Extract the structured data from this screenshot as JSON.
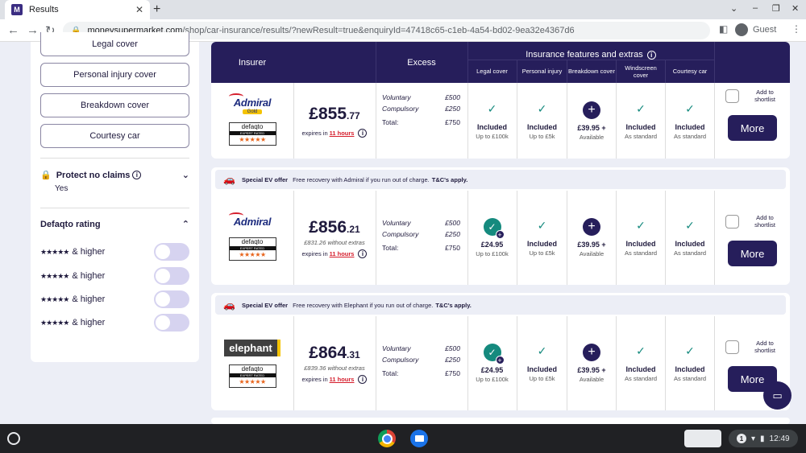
{
  "browser": {
    "tab_title": "Results",
    "favicon_letter": "M",
    "url_domain": "moneysupermarket.com",
    "url_path": "/shop/car-insurance/results/?newResult=true&enquiryId=47418c65-c1eb-4a54-bd02-9ea32e4367d6",
    "profile_label": "Guest"
  },
  "sidebar": {
    "filter_buttons": [
      "Legal cover",
      "Personal injury cover",
      "Breakdown cover",
      "Courtesy car"
    ],
    "protect_no_claims": {
      "label": "Protect no claims",
      "value": "Yes"
    },
    "defaqto": {
      "heading": "Defaqto rating",
      "rows": [
        {
          "stars": "★★★★★",
          "label": "& higher"
        },
        {
          "stars": "★★★★★",
          "label": "& higher"
        },
        {
          "stars": "★★★★★",
          "label": "& higher"
        },
        {
          "stars": "★★★★★",
          "label": "& higher"
        }
      ]
    }
  },
  "table_header": {
    "insurer": "Insurer",
    "excess": "Excess",
    "features_title": "Insurance features and extras",
    "features": [
      "Legal cover",
      "Personal injury",
      "Breakdown cover",
      "Windscreen cover",
      "Courtesy car"
    ]
  },
  "results": [
    {
      "insurer_logo": "Admiral",
      "insurer_badge": "Gold",
      "defaqto": {
        "name": "defaqto",
        "band": "EXPERT RATED",
        "stars": "★★★★★"
      },
      "price_major": "£855",
      "price_minor": ".77",
      "without_extras": "",
      "expires_prefix": "expires in",
      "expires_hours": "11 hours",
      "excess": {
        "voluntary_label": "Voluntary",
        "voluntary": "£500",
        "compulsory_label": "Compulsory",
        "compulsory": "£250",
        "total_label": "Total:",
        "total": "£750"
      },
      "features": [
        {
          "icon": "tick",
          "value": "Included",
          "sub": "Up to £100k"
        },
        {
          "icon": "tick",
          "value": "Included",
          "sub": "Up to £5k"
        },
        {
          "icon": "plus",
          "value": "£39.95 +",
          "sub": "Available"
        },
        {
          "icon": "tick",
          "value": "Included",
          "sub": "As standard"
        },
        {
          "icon": "tick",
          "value": "Included",
          "sub": "As standard"
        }
      ],
      "shortlist_label": "Add to shortlist",
      "more_label": "More"
    },
    {
      "insurer_logo": "Admiral",
      "insurer_badge": "",
      "defaqto": {
        "name": "defaqto",
        "band": "EXPERT RATED",
        "stars": "★★★★★"
      },
      "price_major": "£856",
      "price_minor": ".21",
      "without_extras": "£831.26 without extras",
      "expires_prefix": "expires in",
      "expires_hours": "11 hours",
      "excess": {
        "voluntary_label": "Voluntary",
        "voluntary": "£500",
        "compulsory_label": "Compulsory",
        "compulsory": "£250",
        "total_label": "Total:",
        "total": "£750"
      },
      "features": [
        {
          "icon": "tick-plus",
          "value": "£24.95",
          "sub": "Up to £100k"
        },
        {
          "icon": "tick",
          "value": "Included",
          "sub": "Up to £5k"
        },
        {
          "icon": "plus",
          "value": "£39.95 +",
          "sub": "Available"
        },
        {
          "icon": "tick",
          "value": "Included",
          "sub": "As standard"
        },
        {
          "icon": "tick",
          "value": "Included",
          "sub": "As standard"
        }
      ],
      "shortlist_label": "Add to shortlist",
      "more_label": "More",
      "ev_offer": {
        "title": "Special EV offer",
        "text": "Free recovery with Admiral if you run out of charge.",
        "tcs": "T&C's apply."
      }
    },
    {
      "insurer_logo": "elephant",
      "insurer_badge": "",
      "defaqto": {
        "name": "defaqto",
        "band": "EXPERT RATED",
        "stars": "★★★★★"
      },
      "price_major": "£864",
      "price_minor": ".31",
      "without_extras": "£839.36 without extras",
      "expires_prefix": "expires in",
      "expires_hours": "11 hours",
      "excess": {
        "voluntary_label": "Voluntary",
        "voluntary": "£500",
        "compulsory_label": "Compulsory",
        "compulsory": "£250",
        "total_label": "Total:",
        "total": "£750"
      },
      "features": [
        {
          "icon": "tick-plus",
          "value": "£24.95",
          "sub": "Up to £100k"
        },
        {
          "icon": "tick",
          "value": "Included",
          "sub": "Up to £5k"
        },
        {
          "icon": "plus",
          "value": "£39.95 +",
          "sub": "Available"
        },
        {
          "icon": "tick",
          "value": "Included",
          "sub": "As standard"
        },
        {
          "icon": "tick",
          "value": "Included",
          "sub": "As standard"
        }
      ],
      "shortlist_label": "Add to shortlist",
      "more_label": "More",
      "ev_offer": {
        "title": "Special EV offer",
        "text": "Free recovery with Elephant if you run out of charge.",
        "tcs": "T&C's apply."
      }
    }
  ],
  "taskbar": {
    "clock": "12:49",
    "notification_count": "1"
  },
  "colors": {
    "brand_navy": "#261e5b",
    "tick_green": "#158a7e",
    "expires_red": "#d51c2b"
  }
}
